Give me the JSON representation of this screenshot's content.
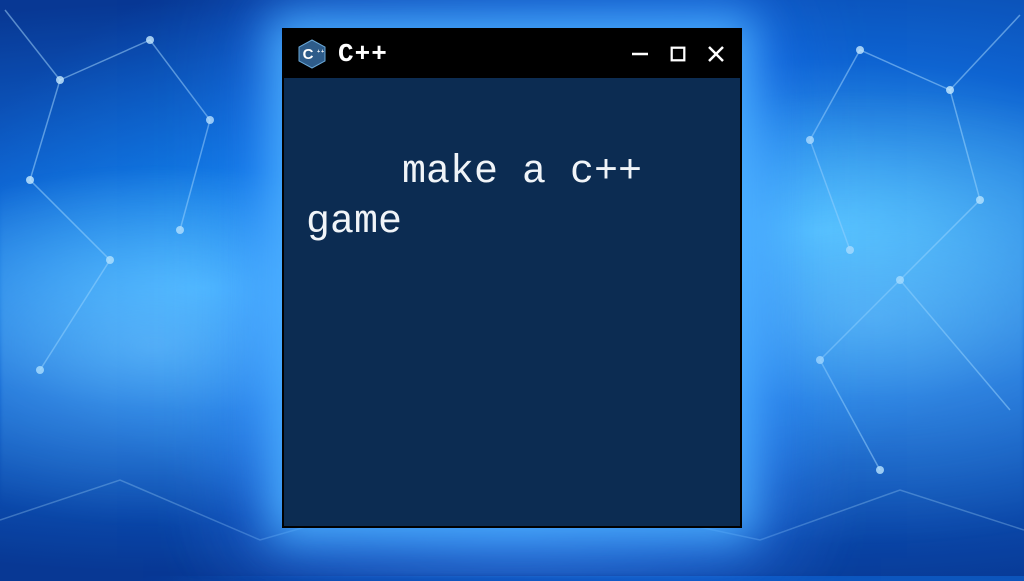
{
  "window": {
    "title": "C++",
    "logo_letter": "C",
    "logo_plus": "++"
  },
  "content": {
    "text": "make a c++ game"
  },
  "colors": {
    "window_bg": "#0c2c52",
    "titlebar_bg": "#000000",
    "logo_fill": "#2e5c8a",
    "glow": "#4ab8ff"
  }
}
